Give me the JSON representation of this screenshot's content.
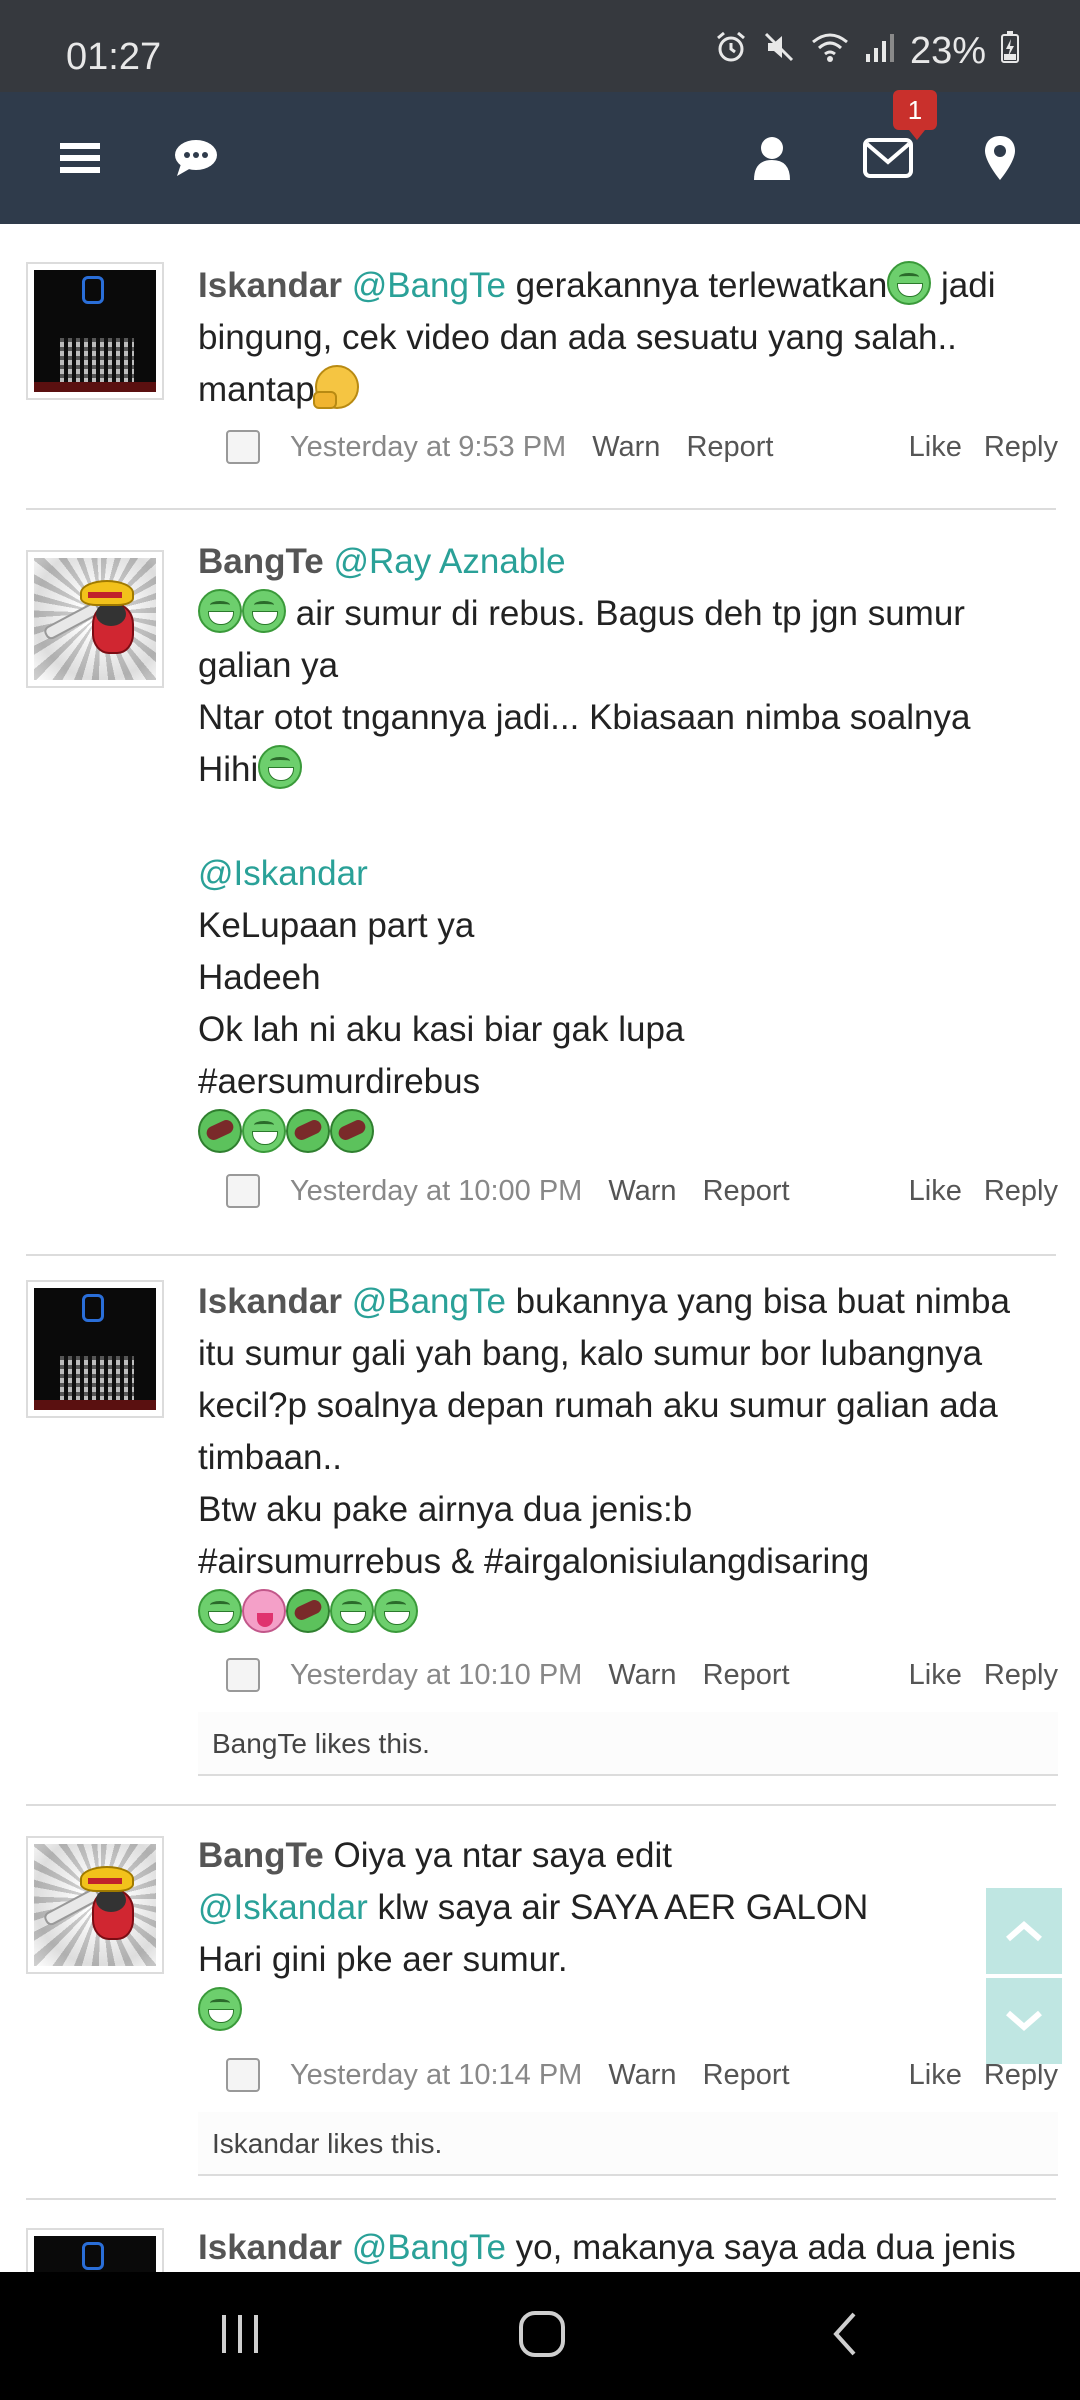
{
  "status_bar": {
    "time": "01:27",
    "battery": "23%",
    "icons": [
      "alarm-icon",
      "mute-icon",
      "wifi-icon",
      "signal-icon",
      "battery-icon"
    ]
  },
  "nav": {
    "icons": [
      "menu-icon",
      "chat-icon",
      "user-icon",
      "mail-icon",
      "location-icon"
    ],
    "mail_badge": "1"
  },
  "posts": [
    {
      "author": "Iskandar",
      "avatar": "qr-avatar",
      "lines": [
        {
          "mention": "@BangTe",
          "text": " gerakannya terlewatkan",
          "tail": " jadi"
        },
        {
          "text": "bingung, cek video dan ada sesuatu yang salah.."
        },
        {
          "text": "mantap"
        }
      ],
      "time": "Yesterday at 9:53 PM",
      "warn": "Warn",
      "report": "Report",
      "like": "Like",
      "reply": "Reply"
    },
    {
      "author": "BangTe",
      "avatar": "toon-avatar",
      "mention_1": "@Ray Aznable",
      "l2": " air sumur di rebus. Bagus deh tp jgn sumur",
      "l3": "galian ya",
      "l4": "Ntar otot tngannya jadi... Kbiasaan nimba soalnya",
      "l5": "Hihi",
      "mention_2": "@Iskandar",
      "l7": "KeLupaan part ya",
      "l8": "Hadeeh",
      "l9": "Ok lah ni aku kasi biar gak lupa",
      "l10": "#aersumurdirebus",
      "time": "Yesterday at 10:00 PM",
      "warn": "Warn",
      "report": "Report",
      "like": "Like",
      "reply": "Reply"
    },
    {
      "author": "Iskandar",
      "avatar": "qr-avatar",
      "mention": "@BangTe",
      "l1": " bukannya yang bisa buat nimba",
      "l2": "itu sumur gali yah bang, kalo sumur bor lubangnya",
      "l3": "kecil?p soalnya depan rumah aku sumur galian ada",
      "l4": "timbaan..",
      "l5": "Btw aku pake airnya dua jenis:b",
      "l6": "#airsumurrebus & #airgalonisiulangdisaring",
      "time": "Yesterday at 10:10 PM",
      "warn": "Warn",
      "report": "Report",
      "like": "Like",
      "reply": "Reply",
      "likes_user": "BangTe",
      "likes_suffix": " likes this."
    },
    {
      "author": "BangTe",
      "avatar": "toon-avatar",
      "l1": " Oiya ya ntar saya edit",
      "mention": "@Iskandar",
      "l2": " klw saya air SAYA AER GALON",
      "l3": "Hari gini pke aer sumur.",
      "time": "Yesterday at 10:14 PM",
      "warn": "Warn",
      "report": "Report",
      "like": "Like",
      "reply": "Reply",
      "likes_user": "Iskandar",
      "likes_suffix": " likes this."
    },
    {
      "author": "Iskandar",
      "avatar": "qr-avatar",
      "mention": "@BangTe",
      "l1": " yo, makanya saya ada dua jenis"
    }
  ],
  "scroll_buttons": [
    "scroll-up-icon",
    "scroll-down-icon"
  ],
  "bottom_nav": [
    "recent-apps-icon",
    "home-icon",
    "back-icon"
  ]
}
